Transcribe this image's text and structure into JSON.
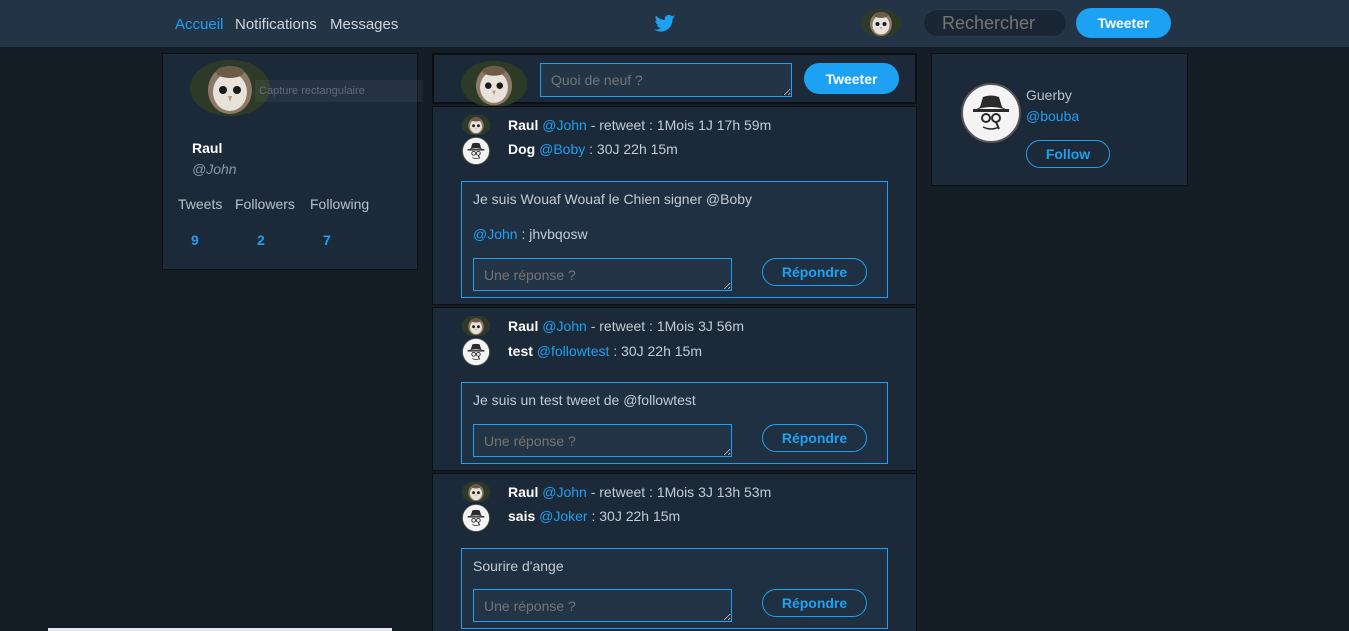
{
  "nav": {
    "home": "Accueil",
    "notifications": "Notifications",
    "messages": "Messages",
    "search_placeholder": "Rechercher",
    "tweet_button": "Tweeter",
    "brand_icon": "twitter-bird-icon"
  },
  "profile": {
    "name": "Raul",
    "handle": "@John",
    "overlay_text": "Capture rectangulaire",
    "stats": [
      {
        "label": "Tweets",
        "value": "9"
      },
      {
        "label": "Followers",
        "value": "2"
      },
      {
        "label": "Following",
        "value": "7"
      }
    ]
  },
  "compose": {
    "placeholder": "Quoi de neuf ?",
    "button": "Tweeter"
  },
  "tweets": [
    {
      "retweeter_name": "Raul",
      "retweeter_handle": "@John",
      "retweet_meta": "- retweet : 1Mois 1J 17h 59m",
      "author_name": "Dog",
      "author_handle": "@Boby",
      "author_meta": ": 30J 22h 15m",
      "text": "Je suis Wouaf Wouaf le Chien signer @Boby",
      "reply_handle": "@John",
      "reply_text": ": jhvbqosw",
      "reply_placeholder": "Une réponse ?",
      "reply_button": "Répondre"
    },
    {
      "retweeter_name": "Raul",
      "retweeter_handle": "@John",
      "retweet_meta": "- retweet : 1Mois 3J 56m",
      "author_name": "test",
      "author_handle": "@followtest",
      "author_meta": ": 30J 22h 15m",
      "text": "Je suis un test tweet de @followtest",
      "reply_placeholder": "Une réponse ?",
      "reply_button": "Répondre"
    },
    {
      "retweeter_name": "Raul",
      "retweeter_handle": "@John",
      "retweet_meta": "- retweet : 1Mois 3J 13h 53m",
      "author_name": "sais",
      "author_handle": "@Joker",
      "author_meta": ": 30J 22h 15m",
      "text": "Sourire d'ange",
      "reply_placeholder": "Une réponse ?",
      "reply_button": "Répondre"
    }
  ],
  "suggestion": {
    "name": "Guerby",
    "handle": "@bouba",
    "button": "Follow"
  },
  "colors": {
    "accent": "#1da1f2",
    "background": "#141d26",
    "panel": "#1c2938",
    "topbar": "#243447"
  }
}
